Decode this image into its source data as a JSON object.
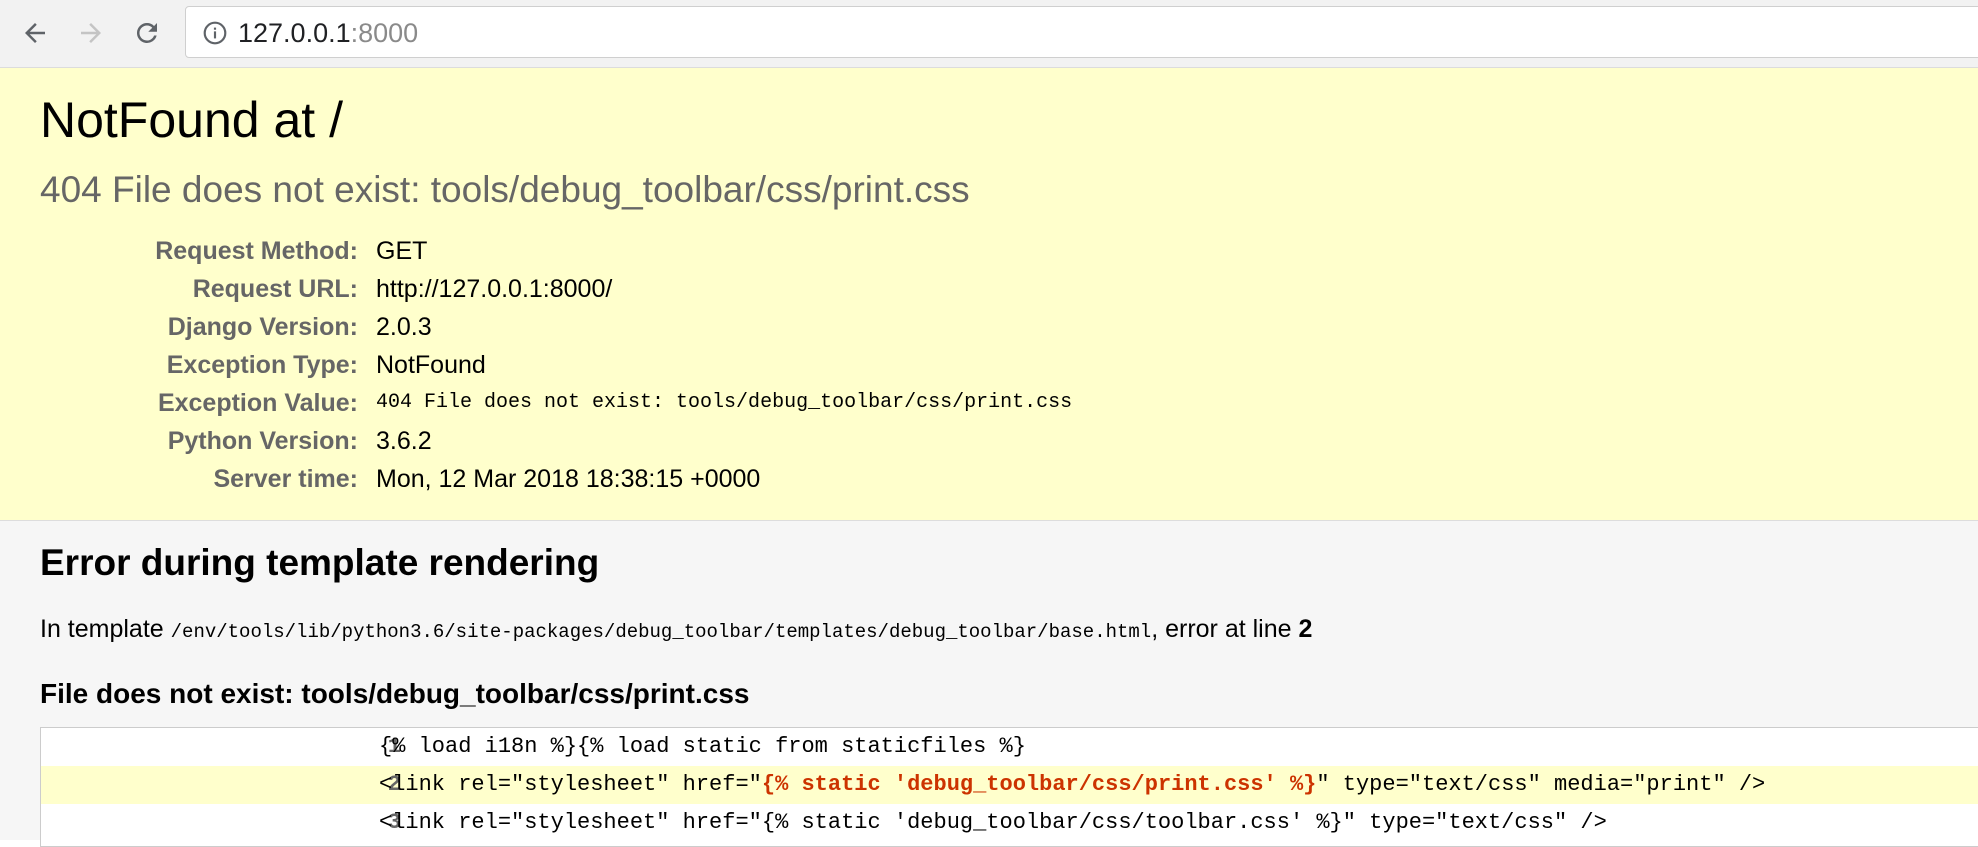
{
  "browser": {
    "url_host": "127.0.0.1",
    "url_port": ":8000",
    "icons": [
      "back-arrow-icon",
      "forward-arrow-icon",
      "reload-icon",
      "info-icon"
    ]
  },
  "summary": {
    "title": "NotFound at /",
    "subtitle": "404 File does not exist: tools/debug_toolbar/css/print.css",
    "meta": [
      {
        "key": "Request Method:",
        "value": "GET"
      },
      {
        "key": "Request URL:",
        "value": "http://127.0.0.1:8000/"
      },
      {
        "key": "Django Version:",
        "value": "2.0.3"
      },
      {
        "key": "Exception Type:",
        "value": "NotFound"
      },
      {
        "key": "Exception Value:",
        "value": "404 File does not exist: tools/debug_toolbar/css/print.css"
      },
      {
        "key": "Python Version:",
        "value": "3.6.2"
      },
      {
        "key": "Server time:",
        "value": "Mon, 12 Mar 2018 18:38:15 +0000"
      }
    ]
  },
  "template": {
    "heading": "Error during template rendering",
    "intro_prefix": "In template ",
    "template_path": "/env/tools/lib/python3.6/site-packages/debug_toolbar/templates/debug_toolbar/base.html",
    "intro_middle": ", error at line ",
    "error_line": "2",
    "error_title": "File does not exist: tools/debug_toolbar/css/print.css",
    "lines": [
      {
        "num": "1",
        "code": "{% load i18n %}{% load static from staticfiles %}"
      },
      {
        "num": "2",
        "before": "<link rel=\"stylesheet\" href=\"",
        "err": "{% static 'debug_toolbar/css/print.css' %}",
        "after": "\" type=\"text/css\" media=\"print\" />"
      },
      {
        "num": "3",
        "code": "<link rel=\"stylesheet\" href=\"{% static 'debug_toolbar/css/toolbar.css' %}\" type=\"text/css\" />"
      }
    ]
  },
  "colors": {
    "summary_bg": "#ffffcc",
    "error_highlight": "#cc3300",
    "muted_text": "#666666"
  }
}
